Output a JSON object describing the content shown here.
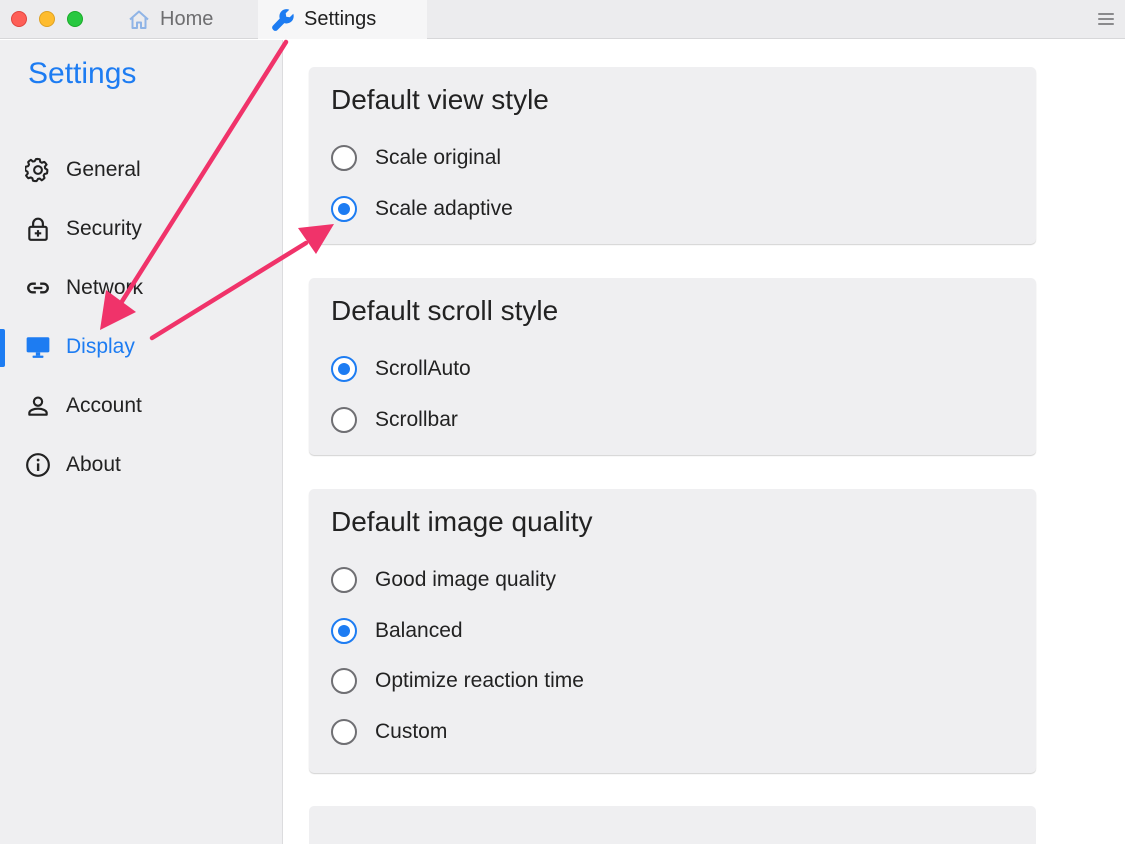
{
  "tabs": [
    {
      "label": "Home",
      "icon": "home-icon"
    },
    {
      "label": "Settings",
      "icon": "wrench-icon"
    }
  ],
  "sidebar": {
    "title": "Settings",
    "items": [
      {
        "label": "General",
        "icon": "gear-icon"
      },
      {
        "label": "Security",
        "icon": "lock-icon"
      },
      {
        "label": "Network",
        "icon": "link-icon"
      },
      {
        "label": "Display",
        "icon": "monitor-icon",
        "active": true
      },
      {
        "label": "Account",
        "icon": "person-icon"
      },
      {
        "label": "About",
        "icon": "info-icon"
      }
    ]
  },
  "sections": [
    {
      "title": "Default view style",
      "options": [
        {
          "label": "Scale original",
          "checked": false
        },
        {
          "label": "Scale adaptive",
          "checked": true
        }
      ]
    },
    {
      "title": "Default scroll style",
      "options": [
        {
          "label": "ScrollAuto",
          "checked": true
        },
        {
          "label": "Scrollbar",
          "checked": false
        }
      ]
    },
    {
      "title": "Default image quality",
      "options": [
        {
          "label": "Good image quality",
          "checked": false
        },
        {
          "label": "Balanced",
          "checked": true
        },
        {
          "label": "Optimize reaction time",
          "checked": false
        },
        {
          "label": "Custom",
          "checked": false
        }
      ]
    }
  ],
  "colors": {
    "accent": "#1d7cf2",
    "annotation_arrow": "#f0336a"
  }
}
